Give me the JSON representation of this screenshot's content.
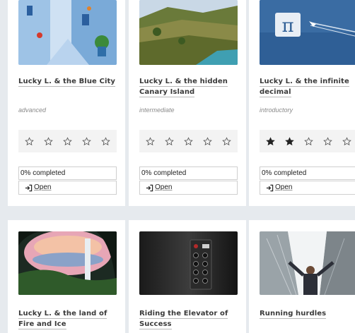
{
  "cards_row1": [
    {
      "title": "Lucky L. & the Blue City",
      "level": "advanced",
      "rating": 0,
      "progress": "0% completed",
      "open_label": "Open"
    },
    {
      "title": "Lucky L. & the hidden Canary Island",
      "level": "intermediate",
      "rating": 0,
      "progress": "0% completed",
      "open_label": "Open"
    },
    {
      "title": "Lucky L. & the infinite decimal",
      "level": "introductory",
      "rating": 2,
      "progress": "0% completed",
      "open_label": "Open"
    }
  ],
  "cards_row2": [
    {
      "title": "Lucky L. & the land of Fire and Ice"
    },
    {
      "title": "Riding the Elevator of Success"
    },
    {
      "title": "Running hurdles"
    }
  ],
  "colors": {
    "page_bg": "#e6eaee",
    "card_bg": "#ffffff",
    "star_filled": "#222222",
    "star_empty": "#555555"
  },
  "icons": {
    "rating": "star-icon",
    "open": "sign-in-icon"
  }
}
